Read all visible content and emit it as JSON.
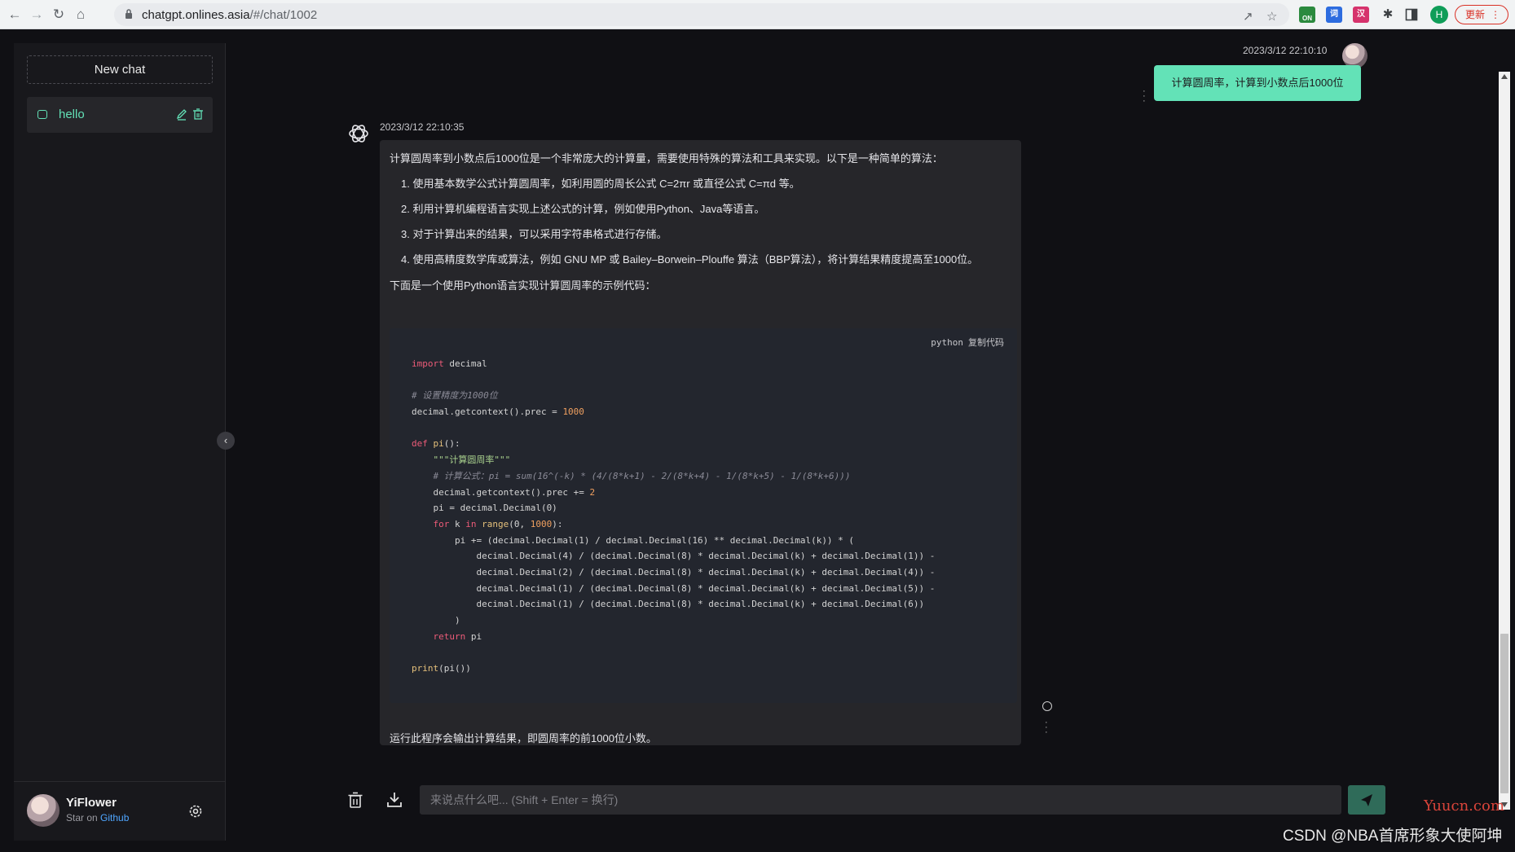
{
  "browser": {
    "url_host": "chatgpt.onlines.asia",
    "url_path": "/#/chat/1002",
    "update_label": "更新",
    "profile_letter": "H",
    "ext_on_label": "ON"
  },
  "sidebar": {
    "new_chat_label": "New chat",
    "chats": [
      {
        "label": "hello"
      }
    ],
    "user": {
      "name": "YiFlower",
      "sub_prefix": "Star on",
      "sub_link": "Github"
    }
  },
  "messages": {
    "user": {
      "time": "2023/3/12 22:10:10",
      "text": "计算圆周率，计算到小数点后1000位"
    },
    "bot": {
      "time": "2023/3/12 22:10:35",
      "intro": "计算圆周率到小数点后1000位是一个非常庞大的计算量，需要使用特殊的算法和工具来实现。以下是一种简单的算法：",
      "list": [
        "1. 使用基本数学公式计算圆周率，如利用圆的周长公式 C=2πr 或直径公式 C=πd 等。",
        "2. 利用计算机编程语言实现上述公式的计算，例如使用Python、Java等语言。",
        "3. 对于计算出来的结果，可以采用字符串格式进行存储。",
        "4. 使用高精度数学库或算法，例如 GNU MP 或 Bailey–Borwein–Plouffe 算法（BBP算法），将计算结果精度提高至1000位。"
      ],
      "code_intro": "下面是一个使用Python语言实现计算圆周率的示例代码：",
      "code_lang": "python",
      "copy_label": "复制代码",
      "code": {
        "l1_kw": "import",
        "l1_rest": " decimal",
        "l2": "# 设置精度为1000位",
        "l3_a": "decimal.getcontext().prec = ",
        "l3_num": "1000",
        "l4_kw": "def",
        "l4_fn": " pi",
        "l4_rest": "():",
        "l5": "    \"\"\"计算圆周率\"\"\"",
        "l6": "    # 计算公式：pi = sum(16^(-k) * (4/(8*k+1) - 2/(8*k+4) - 1/(8*k+5) - 1/(8*k+6)))",
        "l7_a": "    decimal.getcontext().prec += ",
        "l7_num": "2",
        "l8": "    pi = decimal.Decimal(0)",
        "l9_kw": "    for",
        "l9_a": " k ",
        "l9_kw2": "in",
        "l9_fn": " range",
        "l9_b": "(0, ",
        "l9_num": "1000",
        "l9_c": "):",
        "l10": "        pi += (decimal.Decimal(1) / decimal.Decimal(16) ** decimal.Decimal(k)) * (",
        "l11": "            decimal.Decimal(4) / (decimal.Decimal(8) * decimal.Decimal(k) + decimal.Decimal(1)) -",
        "l12": "            decimal.Decimal(2) / (decimal.Decimal(8) * decimal.Decimal(k) + decimal.Decimal(4)) -",
        "l13": "            decimal.Decimal(1) / (decimal.Decimal(8) * decimal.Decimal(k) + decimal.Decimal(5)) -",
        "l14": "            decimal.Decimal(1) / (decimal.Decimal(8) * decimal.Decimal(k) + decimal.Decimal(6))",
        "l15": "        )",
        "l16_kw": "    return",
        "l16_rest": " pi",
        "l17_fn": "print",
        "l17_rest": "(pi())"
      },
      "outro": "运行此程序会输出计算结果，即圆周率的前1000位小数。"
    }
  },
  "input": {
    "placeholder": "来说点什么吧... (Shift + Enter = 换行)"
  },
  "watermarks": {
    "site": "Yuucn.com",
    "credit": "CSDN @NBA首席形象大使阿坤"
  },
  "colors": {
    "accent": "#63e2b7",
    "background": "#101014",
    "sidebar": "#18181c",
    "bubble": "#26262a",
    "code_bg": "#23262e"
  }
}
